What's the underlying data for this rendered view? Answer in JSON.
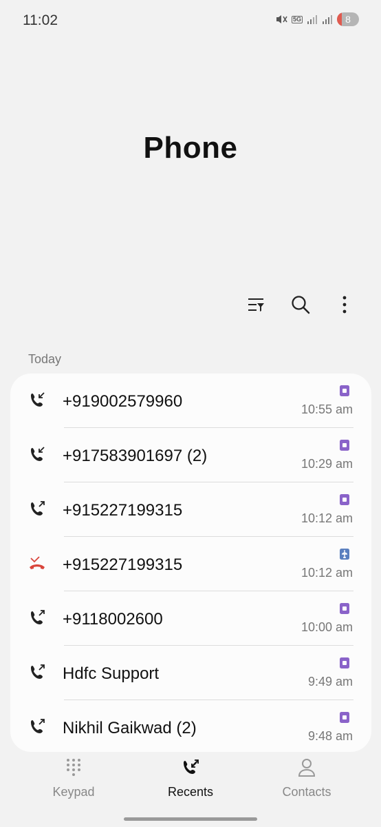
{
  "status_bar": {
    "time": "11:02",
    "network": "5G",
    "battery": "8"
  },
  "title": "Phone",
  "toolbar": {
    "filter_icon": "filter-icon",
    "search_icon": "search-icon",
    "more_icon": "more-vert-icon"
  },
  "section_label": "Today",
  "calls": [
    {
      "name": "+919002579960",
      "time": "10:55 am",
      "type": "incoming",
      "sim": "sim"
    },
    {
      "name": "+917583901697 (2)",
      "time": "10:29 am",
      "type": "incoming",
      "sim": "sim"
    },
    {
      "name": "+915227199315",
      "time": "10:12 am",
      "type": "outgoing",
      "sim": "sim"
    },
    {
      "name": "+915227199315",
      "time": "10:12 am",
      "type": "missed",
      "sim": "airplane"
    },
    {
      "name": "+9118002600",
      "time": "10:00 am",
      "type": "outgoing",
      "sim": "sim"
    },
    {
      "name": "Hdfc Support",
      "time": "9:49 am",
      "type": "outgoing",
      "sim": "sim"
    },
    {
      "name": "Nikhil Gaikwad (2)",
      "time": "9:48 am",
      "type": "outgoing",
      "sim": "sim"
    }
  ],
  "nav": {
    "keypad": "Keypad",
    "recents": "Recents",
    "contacts": "Contacts"
  },
  "colors": {
    "sim": "#8a63c9",
    "airplane_badge": "#5a7fbf",
    "missed": "#d9453b"
  }
}
